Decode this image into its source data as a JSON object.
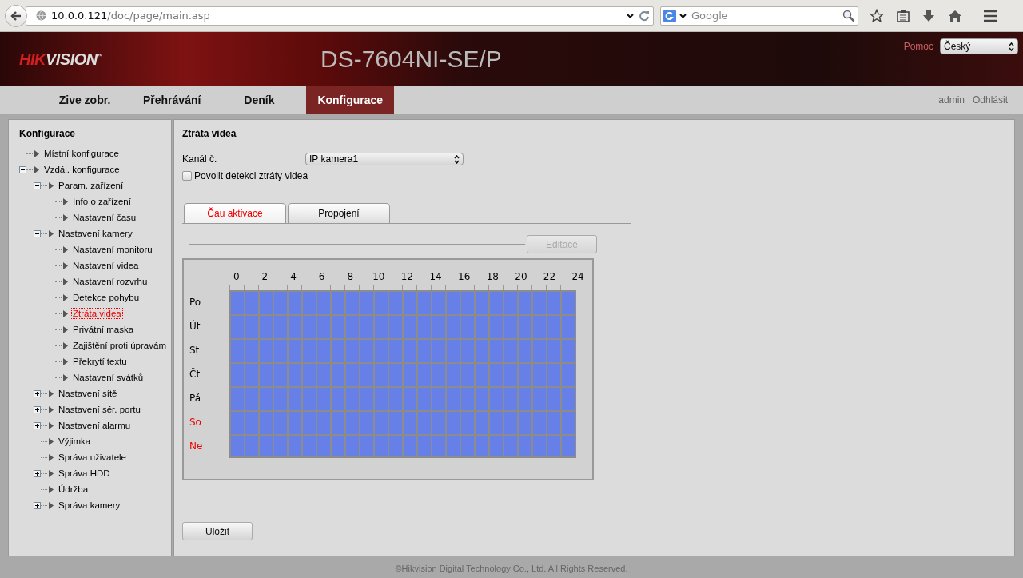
{
  "browser": {
    "url": {
      "host": "10.0.0.121",
      "path": "/doc/page/main.asp"
    },
    "search": {
      "placeholder": "Google"
    }
  },
  "header": {
    "logo": {
      "accent": "HIK",
      "rest": "VISION",
      "mark": "™"
    },
    "model": "DS-7604NI-SE/P",
    "help": "Pomoc",
    "language": "Český"
  },
  "nav": {
    "tabs": [
      {
        "label": "Zive zobr.",
        "selected": false
      },
      {
        "label": "Přehrávání",
        "selected": false
      },
      {
        "label": "Deník",
        "selected": false
      },
      {
        "label": "Konfigurace",
        "selected": true
      }
    ],
    "user": "admin",
    "logout": "Odhlásit"
  },
  "sidebar": {
    "title": "Konfigurace",
    "tree": [
      {
        "label": "Místní konfigurace",
        "selected": false
      },
      {
        "label": "Vzdál. konfigurace",
        "selected": false,
        "expanded": true,
        "children": [
          {
            "label": "Param. zařízení",
            "selected": false,
            "expanded": true,
            "children": [
              {
                "label": "Info o zařízení",
                "selected": false
              },
              {
                "label": "Nastavení času",
                "selected": false
              }
            ]
          },
          {
            "label": "Nastavení kamery",
            "selected": false,
            "expanded": true,
            "children": [
              {
                "label": "Nastavení monitoru",
                "selected": false
              },
              {
                "label": "Nastavení videa",
                "selected": false
              },
              {
                "label": "Nastavení rozvrhu",
                "selected": false
              },
              {
                "label": "Detekce pohybu",
                "selected": false
              },
              {
                "label": "Ztráta videa",
                "selected": true
              },
              {
                "label": "Privátní maska",
                "selected": false
              },
              {
                "label": "Zajištění proti úpravám",
                "selected": false
              },
              {
                "label": "Překrytí textu",
                "selected": false
              },
              {
                "label": "Nastavení svátků",
                "selected": false
              }
            ]
          },
          {
            "label": "Nastavení sítě",
            "selected": false,
            "expanded": false
          },
          {
            "label": "Nastavení sér. portu",
            "selected": false,
            "expanded": false
          },
          {
            "label": "Nastavení alarmu",
            "selected": false,
            "expanded": false
          },
          {
            "label": "Výjimka",
            "selected": false
          },
          {
            "label": "Správa uživatele",
            "selected": false
          },
          {
            "label": "Správa HDD",
            "selected": false,
            "expanded": false
          },
          {
            "label": "Údržba",
            "selected": false
          },
          {
            "label": "Správa kamery",
            "selected": false,
            "expanded": false
          }
        ]
      }
    ]
  },
  "content": {
    "title": "Ztráta videa",
    "channel_label": "Kanál č.",
    "channel_value": "IP kamera1",
    "enable_label": "Povolit detekci ztráty videa",
    "enable_checked": false,
    "tabs": [
      {
        "label": "Čau aktivace",
        "selected": true
      },
      {
        "label": "Propojení",
        "selected": false
      }
    ],
    "edit_button": {
      "label": "Editace",
      "disabled": true
    },
    "schedule": {
      "hour_ticks": [
        "0",
        "2",
        "4",
        "6",
        "8",
        "10",
        "12",
        "14",
        "16",
        "18",
        "20",
        "22",
        "24"
      ],
      "days": [
        {
          "label": "Po",
          "weekend": false,
          "active": true
        },
        {
          "label": "Út",
          "weekend": false,
          "active": true
        },
        {
          "label": "St",
          "weekend": false,
          "active": true
        },
        {
          "label": "Čt",
          "weekend": false,
          "active": true
        },
        {
          "label": "Pá",
          "weekend": false,
          "active": true
        },
        {
          "label": "So",
          "weekend": true,
          "active": true
        },
        {
          "label": "Ne",
          "weekend": true,
          "active": true
        }
      ]
    },
    "save_button": "Uložit"
  },
  "footer": "©Hikvision Digital Technology Co., Ltd. All Rights Reserved."
}
